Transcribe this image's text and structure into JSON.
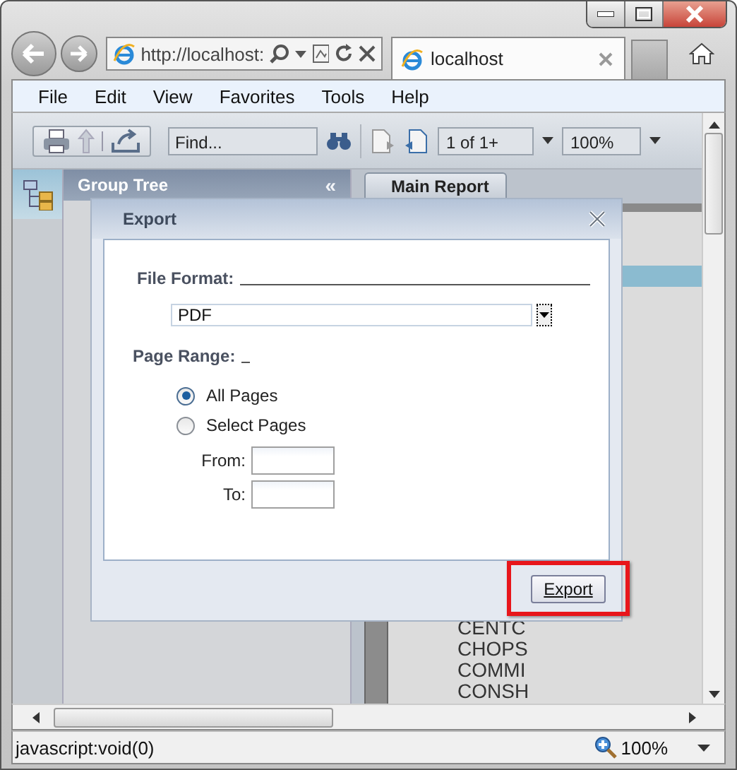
{
  "address_bar": {
    "url": "http://localhost:"
  },
  "tabs": [
    {
      "label": "localhost",
      "selected": true
    }
  ],
  "menu": [
    "File",
    "Edit",
    "View",
    "Favorites",
    "Tools",
    "Help"
  ],
  "toolbar": {
    "find": {
      "placeholder": "Find..."
    },
    "page": "1 of 1+",
    "zoom": "100%"
  },
  "group_tree": {
    "title": "Group Tree",
    "collapse": "«"
  },
  "report": {
    "tab": "Main Report",
    "rows": [
      "CENTC",
      "CHOPS",
      "COMMI",
      "CONSH"
    ]
  },
  "dialog": {
    "title": "Export",
    "file_format_label": "File Format:",
    "format": "PDF",
    "page_range_label": "Page Range:",
    "options": [
      {
        "label": "All Pages",
        "selected": true
      },
      {
        "label": "Select Pages",
        "selected": false
      }
    ],
    "from_label": "From:",
    "to_label": "To:",
    "button": "Export"
  },
  "status_bar": {
    "text": "javascript:void(0)",
    "zoom": "100%"
  }
}
